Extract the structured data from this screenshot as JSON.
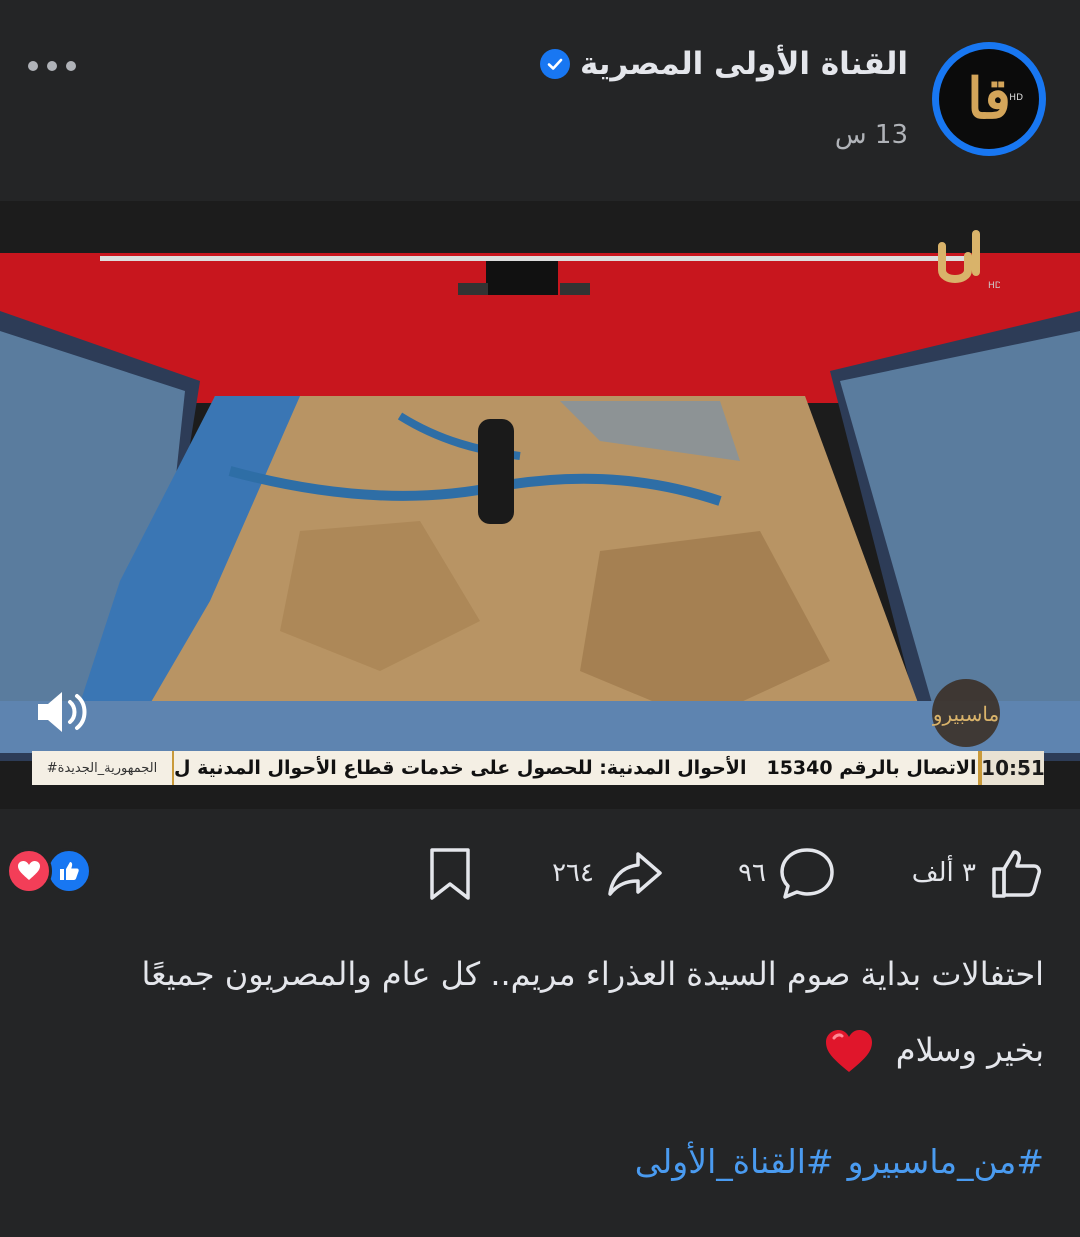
{
  "header": {
    "page_name": "القناة الأولى المصرية",
    "time_ago": "13 س",
    "avatar_logo": "قا",
    "avatar_badge": "HD"
  },
  "video": {
    "channel_logo": "قا",
    "ticker_time": "10:51",
    "ticker_text_1": "الاتصال بالرقم 15340",
    "ticker_text_2": "الأحوال المدنية: للحصول على خدمات قطاع الأحوال المدنية ل",
    "ticker_tag": "#الجمهورية_الجديدة"
  },
  "actions": {
    "likes": "٣ ألف",
    "comments": "٩٦",
    "shares": "٢٦٤"
  },
  "caption": {
    "line1": "احتفالات بداية صوم السيدة العذراء مريم.. كل عام والمصريون جميعًا",
    "line2": "بخير وسلام"
  },
  "hashtags": [
    "#من_ماسبيرو",
    "#القناة_الأولى"
  ],
  "colors": {
    "background": "#242526",
    "accent": "#1877f2",
    "hashtag": "#4a9bf0",
    "heart": "#f33e58"
  }
}
